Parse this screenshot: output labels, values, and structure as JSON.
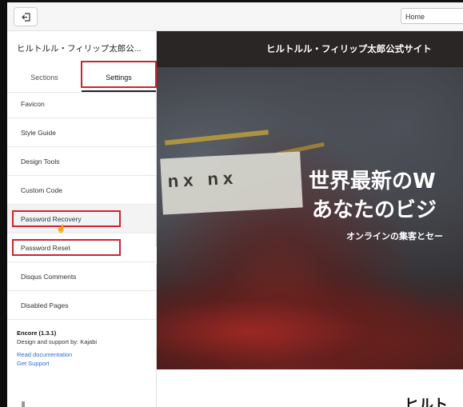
{
  "toolbar": {
    "page_select_value": "Home"
  },
  "sidebar": {
    "site_name": "ヒルトルル・フィリップ太郎公...",
    "tabs": [
      {
        "label": "Sections"
      },
      {
        "label": "Settings"
      }
    ],
    "menu": [
      {
        "label": "Favicon"
      },
      {
        "label": "Style Guide"
      },
      {
        "label": "Design Tools"
      },
      {
        "label": "Custom Code"
      },
      {
        "label": "Password Recovery"
      },
      {
        "label": "Password Reset"
      },
      {
        "label": "Disqus Comments"
      },
      {
        "label": "Disabled Pages"
      }
    ],
    "footer": {
      "theme": "Encore (1.3.1)",
      "support": "Design and support by: Kajabi",
      "docs_link": "Read documentation",
      "support_link": "Get Support"
    }
  },
  "preview": {
    "site_title": "ヒルトルル・フィリップ太郎公式サイト",
    "hero_line1": "世界最新のW",
    "hero_line2": "あなたのビジ",
    "hero_sub": "オンラインの集客とセー",
    "banner_text": "nx nx",
    "bottom_title": "ヒルト"
  },
  "colors": {
    "highlight": "#d0242b",
    "link": "#2a6fd6",
    "header_bg": "#2a2625"
  },
  "icons": {
    "exit": "exit-icon",
    "collapse": "chevron-left-icon",
    "cursor": "hand-cursor-icon"
  }
}
